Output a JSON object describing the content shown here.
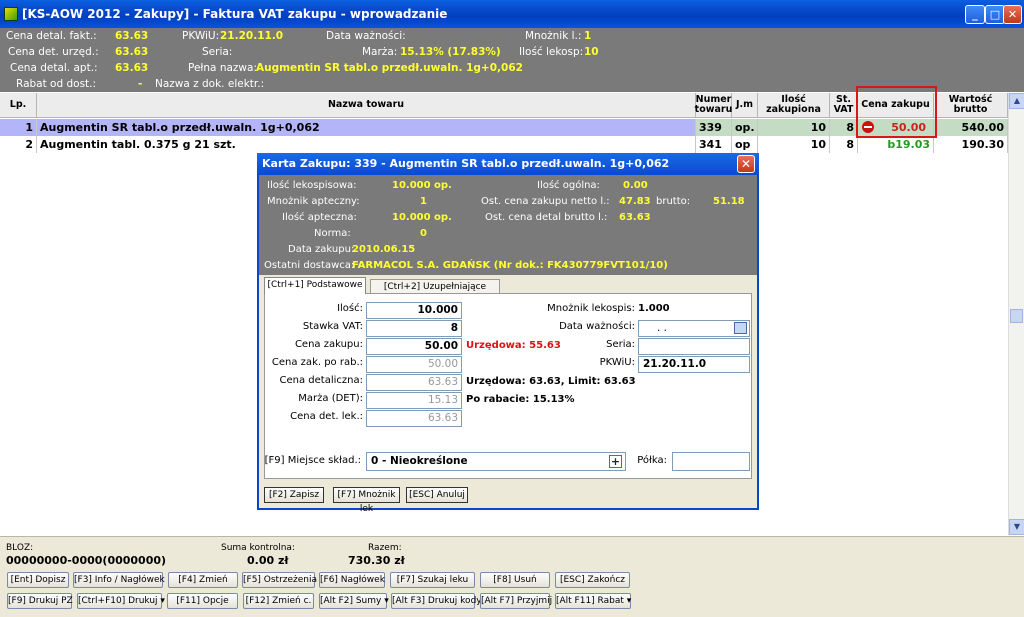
{
  "window": {
    "title": "[KS-AOW 2012 - Zakupy] - Faktura VAT zakupu - wprowadzanie",
    "min": "_",
    "max": "□",
    "close": "✕"
  },
  "header": {
    "cena_detal_fakt_label": "Cena detal. fakt.:",
    "cena_detal_fakt": "63.63",
    "cena_det_urzed_label": "Cena det. urzęd.:",
    "cena_det_urzed": "63.63",
    "cena_detal_apt_label": "Cena detal. apt.:",
    "cena_detal_apt": "63.63",
    "rabat_label": "Rabat od dost.:",
    "rabat": "-",
    "pkwiu_label": "PKWiU:",
    "pkwiu": "21.20.11.0",
    "seria_label": "Seria:",
    "pelna_nazwa_label": "Pełna nazwa:",
    "pelna_nazwa": "Augmentin SR tabl.o przedł.uwaln. 1g+0,062",
    "nazwa_dok_label": "Nazwa z dok. elektr.:",
    "data_waznosci_label": "Data ważności:",
    "marza_label": "Marża:",
    "marza": "15.13% (17.83%)",
    "mnoznik_label": "Mnożnik l.:",
    "mnoznik": "1",
    "ilosc_lekosp_label": "Ilość lekosp:",
    "ilosc_lekosp": "10"
  },
  "grid": {
    "columns": [
      "Lp.",
      "Nazwa towaru",
      "Numer towaru",
      "J.m",
      "Ilość zakupiona",
      "St. VAT",
      "Cena zakupu",
      "Wartość brutto"
    ],
    "rows": [
      {
        "lp": "1",
        "nazwa": "Augmentin SR tabl.o przedł.uwaln. 1g+0,062",
        "numer": "339",
        "jm": "op.",
        "ilosc": "10",
        "vat": "8",
        "cena": "50.00",
        "wartosc": "540.00"
      },
      {
        "lp": "2",
        "nazwa": "Augmentin tabl. 0.375 g 21 szt.",
        "numer": "341",
        "jm": "op",
        "ilosc": "10",
        "vat": "8",
        "cena": "b19.03",
        "wartosc": "190.30"
      }
    ]
  },
  "dialog": {
    "title": "Karta Zakupu: 339 - Augmentin SR tabl.o przedł.uwaln. 1g+0,062",
    "info": {
      "ilosc_lekospisowa_label": "Ilość lekospisowa:",
      "ilosc_lekospisowa": "10.000",
      "op1": "op.",
      "mnoznik_apteczny_label": "Mnożnik apteczny:",
      "mnoznik_apteczny": "1",
      "ilosc_apteczna_label": "Ilość apteczna:",
      "ilosc_apteczna": "10.000",
      "op2": "op.",
      "norma_label": "Norma:",
      "norma": "0",
      "data_zakupu_label": "Data zakupu:",
      "data_zakupu": "2010.06.15",
      "ostatni_dostawca_label": "Ostatni dostawca:",
      "ostatni_dostawca": "FARMACOL S.A. GDAŃSK   (Nr dok.: FK430779FVT101/10)",
      "ilosc_ogolna_label": "Ilość ogólna:",
      "ilosc_ogolna": "0.00",
      "ost_cena_netto_label": "Ost. cena zakupu netto l.:",
      "ost_cena_netto": "47.83",
      "brutto_label": "brutto:",
      "brutto": "51.18",
      "ost_cena_detal_label": "Ost. cena detal brutto l.:",
      "ost_cena_detal": "63.63"
    },
    "tabs": [
      "[Ctrl+1] Podstawowe",
      "[Ctrl+2] Uzupełniające"
    ],
    "form": {
      "ilosc_label": "Ilość:",
      "ilosc": "10.000",
      "stawka_vat_label": "Stawka VAT:",
      "stawka_vat": "8",
      "cena_zakupu_label": "Cena zakupu:",
      "cena_zakupu": "50.00",
      "urzedowa_red": "Urzędowa: 55.63",
      "cena_po_rab_label": "Cena zak. po rab.:",
      "cena_po_rab": "50.00",
      "cena_detaliczna_label": "Cena detaliczna:",
      "cena_detaliczna": "63.63",
      "marza_label": "Marża (DET):",
      "marza": "15.13",
      "cena_det_lek_label": "Cena det. lek.:",
      "cena_det_lek": "63.63",
      "mnoznik_lekosp_label": "Mnożnik lekospis:",
      "mnoznik_lekosp": "1.000",
      "data_waznosci_label": "Data ważności:",
      "data_waznosci": ".  .",
      "seria_label": "Seria:",
      "seria": "",
      "pkwiu_label": "PKWiU:",
      "pkwiu": "21.20.11.0",
      "urzedowa_limit": "Urzędowa: 63.63,  Limit: 63.63",
      "po_rabacie": "Po rabacie: 15.13%",
      "miejsce_label": "[F9] Miejsce skład.:",
      "miejsce": "0 - Nieokreślone",
      "polka_label": "Półka:",
      "polka": ""
    },
    "buttons": [
      "[F2] Zapisz",
      "[F7] Mnożnik lek",
      "[ESC] Anuluj"
    ]
  },
  "footer": {
    "bloz_label": "BLOZ:",
    "bloz": "00000000-0000(0000000)",
    "suma_label": "Suma kontrolna:",
    "suma": "0.00 zł",
    "razem_label": "Razem:",
    "razem": "730.30 zł"
  },
  "fbuttons_row1": [
    "[Ent] Dopisz",
    "[F3] Info / Nagłówek",
    "[F4] Zmień",
    "[F5] Ostrzeżenia",
    "[F6] Nagłówek",
    "[F7] Szukaj leku",
    "[F8] Usuń",
    "[ESC] Zakończ"
  ],
  "fbuttons_row2": [
    "[F9] Drukuj PZ",
    "[Ctrl+F10] Drukuj ▾",
    "[F11] Opcje",
    "[F12] Zmień c.",
    "[Alt F2] Sumy ▾",
    "[Alt F3] Drukuj kody",
    "[Alt F7] Przyjmij",
    "[Alt F11] Rabat ▾"
  ],
  "colors": {
    "titlebar": "#0a54d8",
    "header_bg": "#7a7a7a",
    "value_yellow": "#ffff33",
    "row_selected": "#b4b4f8",
    "highlight": "#cc0000"
  }
}
